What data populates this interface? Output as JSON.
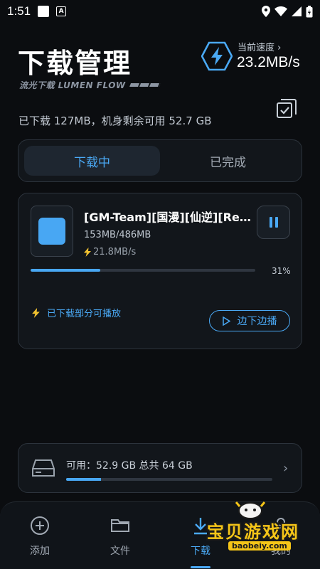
{
  "status_bar": {
    "time": "1:51",
    "badge": "A"
  },
  "header": {
    "title": "下载管理",
    "subtitle": "流光下载 LUMEN FLOW",
    "speed_label": "当前速度 ›",
    "speed_value": "23.2MB/s"
  },
  "storage_summary": "已下载 127MB，机身剩余可用 52.7 GB",
  "tabs": [
    {
      "label": "下载中",
      "active": true
    },
    {
      "label": "已完成",
      "active": false
    }
  ],
  "download": {
    "name": "[GM-Team][国漫][仙逆][Renegade Immortal]",
    "size": "153MB/486MB",
    "rate": "21.8MB/s",
    "progress": 0.31,
    "progress_label": "31%",
    "partial_note": "已下载部分可播放",
    "play_label": "边下边播"
  },
  "storage": {
    "info": "可用：52.9 GB  总共 64 GB",
    "used_fraction": 0.17
  },
  "nav": [
    {
      "label": "添加",
      "icon": "plus-circle-icon"
    },
    {
      "label": "文件",
      "icon": "folder-icon"
    },
    {
      "label": "下载",
      "icon": "download-icon",
      "active": true
    },
    {
      "label": "我的",
      "icon": "user-icon"
    }
  ],
  "watermark": {
    "name": "宝贝游戏网",
    "url": "baobeiy.com"
  },
  "colors": {
    "accent": "#4aa9f5",
    "background": "#0b0d10",
    "card": "#12161b"
  }
}
